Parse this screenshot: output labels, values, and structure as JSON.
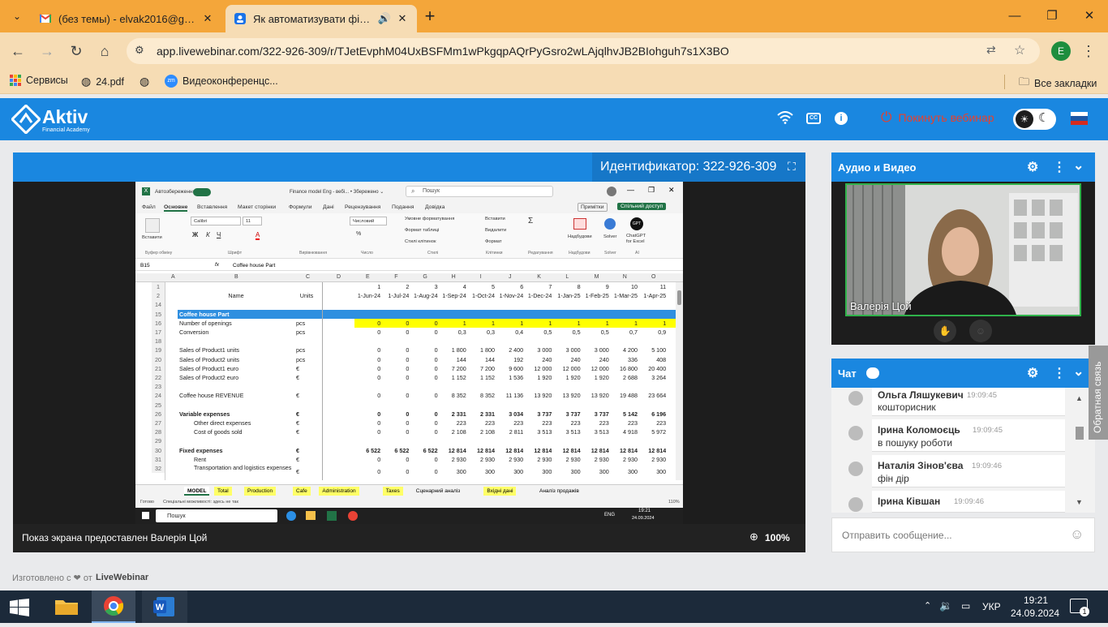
{
  "browser": {
    "tabs": [
      {
        "title": "(без темы) - elvak2016@gmail.",
        "icon": "gmail-icon"
      },
      {
        "title": "Як автоматизувати фінанс",
        "icon": "webinar-icon"
      }
    ],
    "url": "app.livewebinar.com/322-926-309/r/TJetEvphM04UxBSFMm1wPkgqpAQrPyGsro2wLAjqlhvJB2BIohguh7s1X3BO",
    "bookmarks": [
      {
        "label": "Сервисы",
        "icon": "apps-grid-icon"
      },
      {
        "label": "24.pdf",
        "icon": "globe-icon"
      },
      {
        "label": "",
        "icon": "globe-icon"
      },
      {
        "label": "Видеоконференцс...",
        "icon": "zoom-icon"
      }
    ],
    "all_bookmarks": "Все закладки",
    "profile_initial": "E"
  },
  "app": {
    "logo_main": "Aktiv",
    "logo_sub": "Financial Academy",
    "leave_label": "Покинуть вебинар",
    "identifier": "Идентификатор: 322-926-309",
    "screen_share_caption": "Показ экрана предоставлен Валерія Цой",
    "zoom": "100%",
    "footer": "Изготовлено с ❤ от",
    "footer_brand": "LiveWebinar",
    "feedback": "Обратная связь"
  },
  "av_panel": {
    "title": "Аудио и Видео",
    "presenter_name": "Валерія Цой"
  },
  "chat": {
    "title": "Чат",
    "messages": [
      {
        "name": "Ольга Ляшукевич",
        "time": "19:09:45",
        "text": "кошторисник"
      },
      {
        "name": "Ірина Коломоєць",
        "time": "19:09:45",
        "text": "в пошуку роботи"
      },
      {
        "name": "Наталія Зінов'єва",
        "time": "19:09:46",
        "text": "фін дір"
      },
      {
        "name": "Ірина Ківшан",
        "time": "19:09:46",
        "text": ""
      }
    ],
    "input_placeholder": "Отправить сообщение..."
  },
  "excel": {
    "autosave": "Автозбереження",
    "filename": "Finance model Eng - вебі... • Збережено ⌄",
    "search": "Пошук",
    "ribbon_tabs": [
      "Файл",
      "Основне",
      "Вставлення",
      "Макет сторінки",
      "Формули",
      "Дані",
      "Рецензування",
      "Подання",
      "Довідка"
    ],
    "notes_btn": "Примітки",
    "share_btn": "Спільний доступ",
    "font_name": "Calibri",
    "font_size": "11",
    "number_format": "Числовий",
    "ribbon_labels": {
      "paste": "Вставити",
      "conditional": "Умовне форматування",
      "format_table": "Формат таблиці",
      "cell_styles": "Стилі клітинок",
      "insert": "Вставити",
      "delete": "Видалити",
      "format": "Формат",
      "addins": "Надбудови",
      "solver": "Solver",
      "chatgpt": "ChatGPT for Excel",
      "groups": [
        "Буфер обміну",
        "Шрифт",
        "Вирівнювання",
        "Число",
        "Стилі",
        "Клітинки",
        "Редагування",
        "Надбудови",
        "Solver",
        "AI"
      ]
    },
    "name_box": "B15",
    "formula": "Coffee house Part",
    "col_headers": [
      "A",
      "B",
      "C",
      "D",
      "E",
      "F",
      "G",
      "H",
      "I",
      "J",
      "K",
      "L",
      "M",
      "N",
      "O"
    ],
    "header_row1": [
      "1",
      "2",
      "3",
      "4",
      "5",
      "6",
      "7",
      "8",
      "9",
      "10",
      "11"
    ],
    "header_row2_name": "Name",
    "header_row2_units": "Units",
    "dates": [
      "1-Jun-24",
      "1-Jul-24",
      "1-Aug-24",
      "1-Sep-24",
      "1-Oct-24",
      "1-Nov-24",
      "1-Dec-24",
      "1-Jan-25",
      "1-Feb-25",
      "1-Mar-25",
      "1-Apr-25"
    ],
    "rows": [
      {
        "n": "14",
        "name": "",
        "unit": "",
        "vals": []
      },
      {
        "n": "15",
        "name": "Coffee house Part",
        "unit": "",
        "vals": [],
        "style": "section"
      },
      {
        "n": "16",
        "name": "Number of openings",
        "unit": "pcs",
        "vals": [
          "0",
          "0",
          "0",
          "1",
          "1",
          "1",
          "1",
          "1",
          "1",
          "1",
          "1"
        ],
        "style": "yellow"
      },
      {
        "n": "17",
        "name": "Conversion",
        "unit": "pcs",
        "vals": [
          "0",
          "0",
          "0",
          "0,3",
          "0,3",
          "0,4",
          "0,5",
          "0,5",
          "0,5",
          "0,7",
          "0,9"
        ]
      },
      {
        "n": "18",
        "name": "",
        "unit": "",
        "vals": []
      },
      {
        "n": "19",
        "name": "Sales of Product1 units",
        "unit": "pcs",
        "vals": [
          "0",
          "0",
          "0",
          "1 800",
          "1 800",
          "2 400",
          "3 000",
          "3 000",
          "3 000",
          "4 200",
          "5 100"
        ]
      },
      {
        "n": "20",
        "name": "Sales of Product2 units",
        "unit": "pcs",
        "vals": [
          "0",
          "0",
          "0",
          "144",
          "144",
          "192",
          "240",
          "240",
          "240",
          "336",
          "408"
        ]
      },
      {
        "n": "21",
        "name": "Sales of Product1 euro",
        "unit": "€",
        "vals": [
          "0",
          "0",
          "0",
          "7 200",
          "7 200",
          "9 600",
          "12 000",
          "12 000",
          "12 000",
          "16 800",
          "20 400"
        ]
      },
      {
        "n": "22",
        "name": "Sales of Product2 euro",
        "unit": "€",
        "vals": [
          "0",
          "0",
          "0",
          "1 152",
          "1 152",
          "1 536",
          "1 920",
          "1 920",
          "1 920",
          "2 688",
          "3 264"
        ]
      },
      {
        "n": "23",
        "name": "",
        "unit": "",
        "vals": []
      },
      {
        "n": "24",
        "name": "Coffee house REVENUE",
        "unit": "€",
        "vals": [
          "0",
          "0",
          "0",
          "8 352",
          "8 352",
          "11 136",
          "13 920",
          "13 920",
          "13 920",
          "19 488",
          "23 664"
        ]
      },
      {
        "n": "25",
        "name": "",
        "unit": "",
        "vals": []
      },
      {
        "n": "26",
        "name": "Variable expenses",
        "unit": "€",
        "vals": [
          "0",
          "0",
          "0",
          "2 331",
          "2 331",
          "3 034",
          "3 737",
          "3 737",
          "3 737",
          "5 142",
          "6 196"
        ],
        "style": "bold"
      },
      {
        "n": "27",
        "name": "Other direct expenses",
        "unit": "€",
        "vals": [
          "0",
          "0",
          "0",
          "223",
          "223",
          "223",
          "223",
          "223",
          "223",
          "223",
          "223"
        ],
        "style": "indent"
      },
      {
        "n": "28",
        "name": "Cost of goods sold",
        "unit": "€",
        "vals": [
          "0",
          "0",
          "0",
          "2 108",
          "2 108",
          "2 811",
          "3 513",
          "3 513",
          "3 513",
          "4 918",
          "5 972"
        ],
        "style": "indent"
      },
      {
        "n": "29",
        "name": "",
        "unit": "",
        "vals": []
      },
      {
        "n": "30",
        "name": "Fixed expenses",
        "unit": "€",
        "vals": [
          "6 522",
          "6 522",
          "6 522",
          "12 814",
          "12 814",
          "12 814",
          "12 814",
          "12 814",
          "12 814",
          "12 814",
          "12 814"
        ],
        "style": "bold"
      },
      {
        "n": "31",
        "name": "Rent",
        "unit": "€",
        "vals": [
          "0",
          "0",
          "0",
          "2 930",
          "2 930",
          "2 930",
          "2 930",
          "2 930",
          "2 930",
          "2 930",
          "2 930"
        ],
        "style": "indent"
      },
      {
        "n": "32",
        "name": "Transportation and logistics expenses",
        "unit": "€",
        "vals": [
          "0",
          "0",
          "0",
          "300",
          "300",
          "300",
          "300",
          "300",
          "300",
          "300",
          "300"
        ],
        "style": "indent2"
      }
    ],
    "sheet_tabs": [
      "MODEL",
      "Total",
      "Production",
      "Cafe",
      "Administration",
      "Taxes",
      "Сценарний аналіз",
      "Вхідні дані",
      "Аналіз продажів"
    ],
    "status_left": "Готово",
    "status_acc": "Спеціальні можливості: здесь не так",
    "status_zoom": "110%",
    "taskbar_search": "Пошук",
    "taskbar_time": "19:21",
    "taskbar_date": "24.09.2024",
    "taskbar_lang": "ENG"
  },
  "windows": {
    "lang": "УКР",
    "time": "19:21",
    "date": "24.09.2024",
    "notif_count": "1"
  },
  "colors": {
    "chrome_tabbar": "#f4a63a",
    "chrome_toolbar": "#f6dcb4",
    "app_blue": "#1a87e0",
    "leave_red": "#e8402c",
    "excel_green": "#217346",
    "yellow": "#ffff00",
    "section_blue": "#2f8fe0"
  }
}
